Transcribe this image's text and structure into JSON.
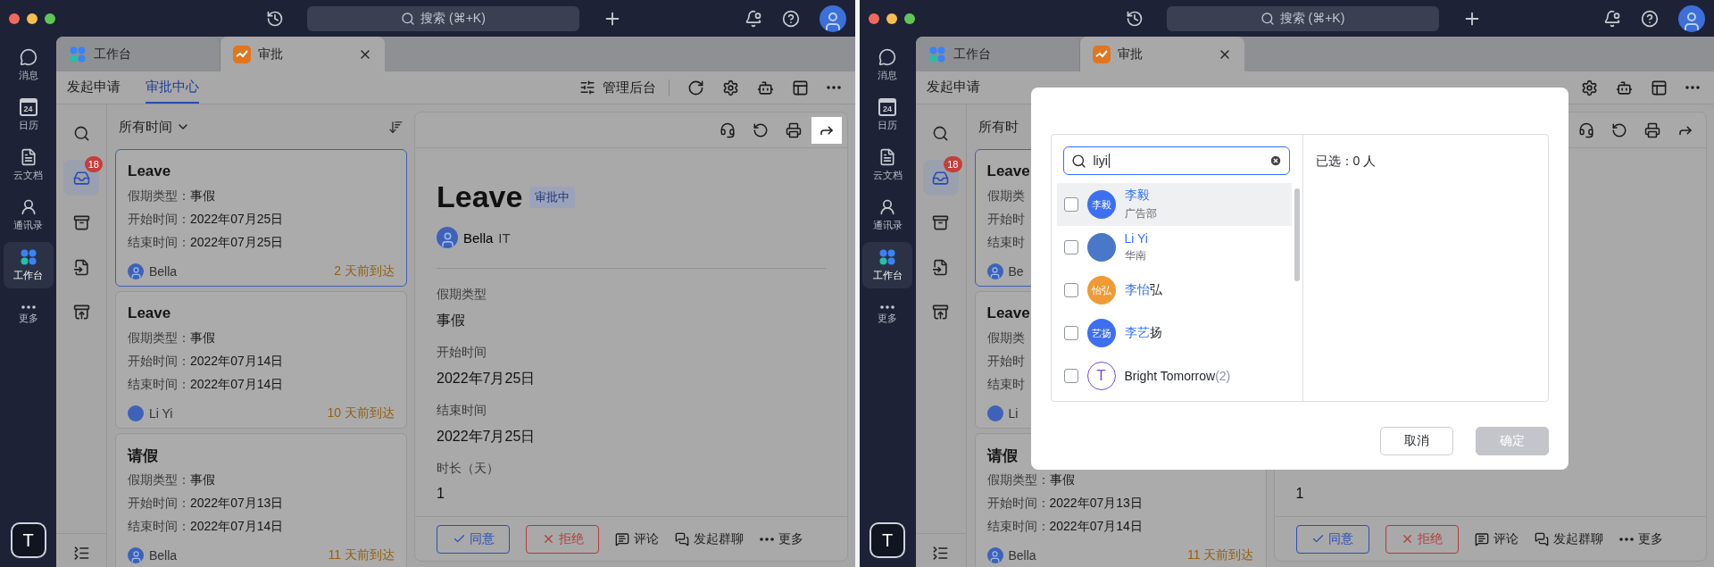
{
  "windows": [
    {
      "rail": {
        "items": [
          {
            "label": "消息",
            "selected": false
          },
          {
            "day": "24",
            "label": "日历",
            "selected": false
          },
          {
            "label": "云文档",
            "selected": false
          },
          {
            "label": "通讯录",
            "selected": false
          },
          {
            "label": "工作台",
            "selected": true
          },
          {
            "label": "更多",
            "selected": false
          }
        ],
        "user_initial": "T"
      },
      "search": {
        "placeholder": "搜索 (⌘+K)"
      },
      "tabs": [
        {
          "label": "工作台",
          "selected": false
        },
        {
          "label": "审批",
          "selected": true
        }
      ],
      "subnav": {
        "tabs": [
          {
            "label": "发起申请",
            "selected": false
          },
          {
            "label": "审批中心",
            "selected": true
          }
        ],
        "admin": "管理后台",
        "refresh_covered": false
      },
      "side_tools": [
        {
          "selected": false
        },
        {
          "selected": true,
          "badge": "18"
        },
        {
          "selected": false
        },
        {
          "selected": false
        },
        {
          "selected": false
        }
      ],
      "list": {
        "filter": "所有时间",
        "filter_menu": true,
        "sortable": true,
        "cards": [
          {
            "title": "Leave",
            "selected": true,
            "lines": [
              {
                "label": "假期类型：",
                "value": "事假"
              },
              {
                "label": "开始时间：",
                "value": "2022年07月25日"
              },
              {
                "label": "结束时间：",
                "value": "2022年07月25日"
              }
            ],
            "avatar_photo": true,
            "author": "Bella",
            "arrived": "2 天前到达"
          },
          {
            "title": "Leave",
            "selected": false,
            "lines": [
              {
                "label": "假期类型：",
                "value": "事假"
              },
              {
                "label": "开始时间：",
                "value": "2022年07月14日"
              },
              {
                "label": "结束时间：",
                "value": "2022年07月14日"
              }
            ],
            "avatar_photo": false,
            "author": "Li Yi",
            "arrived": "10 天前到达"
          },
          {
            "title": "请假",
            "selected": false,
            "lines": [
              {
                "label": "假期类型：",
                "value": "事假"
              },
              {
                "label": "开始时间：",
                "value": "2022年07月13日"
              },
              {
                "label": "结束时间：",
                "value": "2022年07月14日"
              }
            ],
            "avatar_photo": true,
            "author": "Bella",
            "arrived": "11 天前到达"
          }
        ]
      },
      "detail": {
        "tools": [
          {
            "highlighted": false
          },
          {
            "highlighted": false
          },
          {
            "highlighted": false
          },
          {
            "highlighted": true
          }
        ],
        "title": "Leave",
        "status": "审批中",
        "applicant": "Bella",
        "department": "IT",
        "fields": [
          {
            "label": "假期类型",
            "value": "事假"
          },
          {
            "label": "开始时间",
            "value": "2022年7月25日"
          },
          {
            "label": "结束时间",
            "value": "2022年7月25日"
          },
          {
            "label": "时长（天）",
            "value": "1"
          }
        ],
        "actions": [
          {
            "kind": "approve",
            "label": "同意"
          },
          {
            "kind": "reject",
            "label": "拒绝"
          },
          {
            "kind": "comment",
            "label": "评论"
          },
          {
            "kind": "group-chat",
            "label": "发起群聊"
          },
          {
            "kind": "more",
            "label": "更多"
          }
        ]
      }
    },
    {
      "rail": {
        "items": [
          {
            "label": "消息",
            "selected": false
          },
          {
            "day": "24",
            "label": "日历",
            "selected": false
          },
          {
            "label": "云文档",
            "selected": false
          },
          {
            "label": "通讯录",
            "selected": false
          },
          {
            "label": "工作台",
            "selected": true
          },
          {
            "label": "更多",
            "selected": false
          }
        ],
        "user_initial": "T"
      },
      "search": {
        "placeholder": "搜索 (⌘+K)"
      },
      "tabs": [
        {
          "label": "工作台",
          "selected": false
        },
        {
          "label": "审批",
          "selected": true
        }
      ],
      "subnav": {
        "tabs": [
          {
            "label": "发起申请",
            "selected": false
          }
        ],
        "refresh_covered": true
      },
      "side_tools": [
        {
          "selected": false
        },
        {
          "selected": true,
          "badge": "18"
        },
        {
          "selected": false
        },
        {
          "selected": false
        },
        {
          "selected": false
        }
      ],
      "list": {
        "filter": "所有时",
        "filter_menu": false,
        "sortable": false,
        "cards": [
          {
            "title": "Leave",
            "selected": true,
            "lines": [
              {
                "label": "假期类"
              },
              {
                "label": "开始时"
              },
              {
                "label": "结束时"
              }
            ],
            "avatar_photo": true,
            "author": "Be"
          },
          {
            "title": "Leave",
            "selected": false,
            "lines": [
              {
                "label": "假期类"
              },
              {
                "label": "开始时"
              },
              {
                "label": "结束时"
              }
            ],
            "avatar_photo": false,
            "author": "Li"
          },
          {
            "title": "请假",
            "selected": false,
            "lines": [
              {
                "label": "假期类型：",
                "value": "事假"
              },
              {
                "label": "开始时间：",
                "value": "2022年07月13日"
              },
              {
                "label": "结束时间：",
                "value": "2022年07月14日"
              }
            ],
            "avatar_photo": true,
            "author": "Bella",
            "arrived": "11 天前到达"
          }
        ]
      },
      "detail": {
        "tools": [
          {
            "highlighted": false
          },
          {
            "highlighted": false
          },
          {
            "highlighted": false
          },
          {
            "highlighted": false
          }
        ],
        "fields": [
          {
            "value": "1"
          }
        ],
        "actions": [
          {
            "kind": "approve",
            "label": "同意"
          },
          {
            "kind": "reject",
            "label": "拒绝"
          },
          {
            "kind": "comment",
            "label": "评论"
          },
          {
            "kind": "group-chat",
            "label": "发起群聊"
          },
          {
            "kind": "more",
            "label": "更多"
          }
        ]
      },
      "dialog": {
        "search_value": "liyi",
        "summary": "已选：0 人",
        "results": [
          {
            "avatar": {
              "kind": "initials",
              "text": "李毅",
              "color": "#3d6ff0"
            },
            "match": "李毅",
            "subtitle": "广告部",
            "checked": false,
            "highlighted": true
          },
          {
            "avatar": {
              "kind": "plain",
              "color": "#4a78c8"
            },
            "match": "Li Yi",
            "subtitle": "华南",
            "checked": false,
            "highlighted": false
          },
          {
            "avatar": {
              "kind": "initials",
              "text": "怡弘",
              "color": "#f09a35"
            },
            "match": "李怡",
            "rest": "弘",
            "checked": false,
            "highlighted": false
          },
          {
            "avatar": {
              "kind": "initials",
              "text": "艺扬",
              "color": "#3d6ff0"
            },
            "match": "李艺",
            "rest": "扬",
            "checked": false,
            "highlighted": false
          },
          {
            "avatar": {
              "kind": "letter",
              "text": "T",
              "color": "#7a4fd6"
            },
            "rest": "Bright Tomorrow",
            "count": "(2)",
            "checked": false,
            "highlighted": false
          }
        ],
        "buttons": [
          {
            "kind": "cancel",
            "label": "取消",
            "disabled": false
          },
          {
            "kind": "confirm",
            "label": "确定",
            "disabled": true
          }
        ]
      }
    }
  ]
}
